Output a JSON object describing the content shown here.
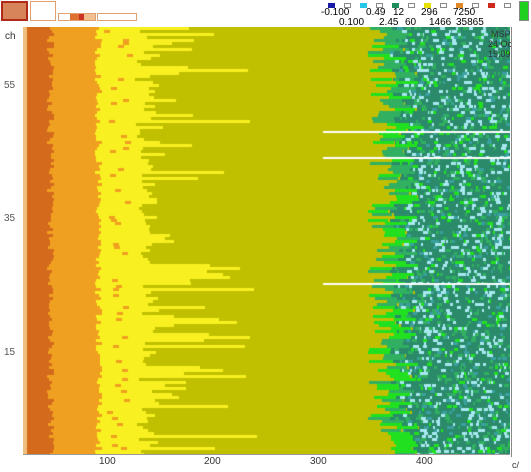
{
  "header": {
    "scale_top": [
      "-0.100",
      "0.49",
      "12",
      "296",
      "7250"
    ],
    "scale_bottom": [
      "0.100",
      "2.45",
      "60",
      "1466",
      "35865"
    ],
    "swatch_colors": [
      "#1a1aa8",
      "#ffffff",
      "#27c7e8",
      "#ffffff",
      "#1c8c5a",
      "#ffffff",
      "#e8e000",
      "#ffffff",
      "#e08a2a",
      "#ffffff",
      "#cc2a1a",
      "#ffffff"
    ]
  },
  "overlay": {
    "line1": "MSP",
    "line2": "24 Oct 15:09"
  },
  "axes": {
    "y_label": "ch",
    "y_ticks": [
      "55",
      "35",
      "15"
    ],
    "x_ticks": [
      "100",
      "200",
      "300",
      "400"
    ],
    "x_label": "c/"
  },
  "colors": {
    "dark_orange": "#d46a1c",
    "orange": "#f0a020",
    "yellow": "#f8f020",
    "olive": "#c0c000",
    "bright_green": "#20e020",
    "mid_green": "#30b060",
    "teal": "#2a8a6a",
    "light_cyan": "#a8e8f0",
    "frame_red": "#cc3322",
    "frame_beige": "#e8a070"
  }
}
